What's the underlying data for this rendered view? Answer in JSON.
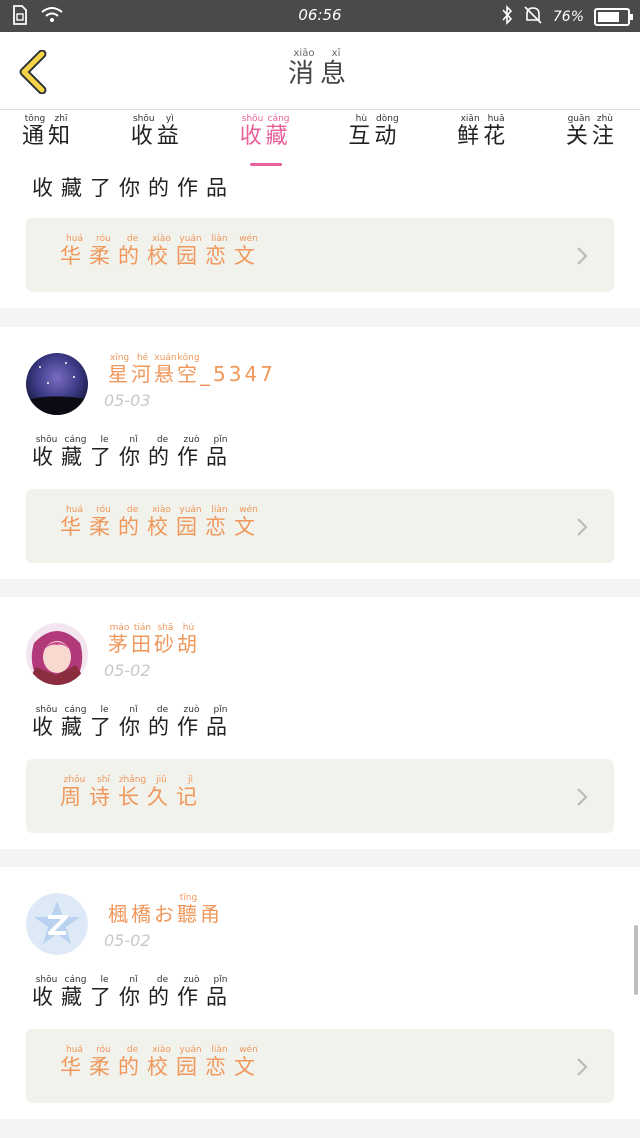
{
  "status": {
    "time": "06:56",
    "battery": "76%",
    "battery_level": 0.76
  },
  "header": {
    "title": [
      [
        "消",
        "xiāo"
      ],
      [
        "息",
        "xī"
      ]
    ]
  },
  "tabs": [
    {
      "label": [
        [
          "通",
          "tōng"
        ],
        [
          "知",
          "zhī"
        ]
      ],
      "active": false
    },
    {
      "label": [
        [
          "收",
          "shōu"
        ],
        [
          "益",
          "yì"
        ]
      ],
      "active": false
    },
    {
      "label": [
        [
          "收",
          "shōu"
        ],
        [
          "藏",
          "cáng"
        ]
      ],
      "active": true
    },
    {
      "label": [
        [
          "互",
          "hù"
        ],
        [
          "动",
          "dòng"
        ]
      ],
      "active": false
    },
    {
      "label": [
        [
          "鲜",
          "xiān"
        ],
        [
          "花",
          "huā"
        ]
      ],
      "active": false
    },
    {
      "label": [
        [
          "关",
          "guān"
        ],
        [
          "注",
          "zhù"
        ]
      ],
      "active": false
    }
  ],
  "first_card": {
    "action": [
      [
        "收",
        ""
      ],
      [
        "藏",
        ""
      ],
      [
        "了",
        ""
      ],
      [
        "你",
        ""
      ],
      [
        "的",
        ""
      ],
      [
        "作",
        ""
      ],
      [
        "品",
        ""
      ]
    ],
    "work": [
      [
        "华",
        "huá"
      ],
      [
        "柔",
        "róu"
      ],
      [
        "的",
        "de"
      ],
      [
        "校",
        "xiào"
      ],
      [
        "园",
        "yuán"
      ],
      [
        "恋",
        "liàn"
      ],
      [
        "文",
        "wén"
      ]
    ]
  },
  "cards": [
    {
      "name": [
        [
          "星",
          "xīng"
        ],
        [
          "河",
          "hé"
        ],
        [
          "悬",
          "xuán"
        ],
        [
          "空",
          "kōng"
        ],
        [
          "_5347",
          ""
        ]
      ],
      "date": "05-03",
      "avatar": "galaxy",
      "action": [
        [
          "收",
          "shōu"
        ],
        [
          "藏",
          "cáng"
        ],
        [
          "了",
          "le"
        ],
        [
          "你",
          "nǐ"
        ],
        [
          "的",
          "de"
        ],
        [
          "作",
          "zuò"
        ],
        [
          "品",
          "pǐn"
        ]
      ],
      "work": [
        [
          "华",
          "huá"
        ],
        [
          "柔",
          "róu"
        ],
        [
          "的",
          "de"
        ],
        [
          "校",
          "xiào"
        ],
        [
          "园",
          "yuán"
        ],
        [
          "恋",
          "liàn"
        ],
        [
          "文",
          "wén"
        ]
      ]
    },
    {
      "name": [
        [
          "茅",
          "máo"
        ],
        [
          "田",
          "tián"
        ],
        [
          "砂",
          "shā"
        ],
        [
          "胡",
          "hú"
        ]
      ],
      "date": "05-02",
      "avatar": "anime",
      "action": [
        [
          "收",
          "shōu"
        ],
        [
          "藏",
          "cáng"
        ],
        [
          "了",
          "le"
        ],
        [
          "你",
          "nǐ"
        ],
        [
          "的",
          "de"
        ],
        [
          "作",
          "zuò"
        ],
        [
          "品",
          "pǐn"
        ]
      ],
      "work": [
        [
          "周",
          "zhōu"
        ],
        [
          "诗",
          "shī"
        ],
        [
          "长",
          "zhǎng"
        ],
        [
          "久",
          "jiǔ"
        ],
        [
          "记",
          "jì"
        ]
      ]
    },
    {
      "name": [
        [
          "楓",
          ""
        ],
        [
          "橋",
          ""
        ],
        [
          "お",
          ""
        ],
        [
          "聽",
          "tīng"
        ],
        [
          "甬",
          ""
        ]
      ],
      "date": "05-02",
      "avatar": "default",
      "action": [
        [
          "收",
          "shōu"
        ],
        [
          "藏",
          "cáng"
        ],
        [
          "了",
          "le"
        ],
        [
          "你",
          "nǐ"
        ],
        [
          "的",
          "de"
        ],
        [
          "作",
          "zuò"
        ],
        [
          "品",
          "pǐn"
        ]
      ],
      "work": [
        [
          "华",
          "huá"
        ],
        [
          "柔",
          "róu"
        ],
        [
          "的",
          "de"
        ],
        [
          "校",
          "xiào"
        ],
        [
          "园",
          "yuán"
        ],
        [
          "恋",
          "liàn"
        ],
        [
          "文",
          "wén"
        ]
      ]
    }
  ],
  "colors": {
    "accent": "#e85f99",
    "orange": "#f0975b",
    "card_bg": "#f2f2ec"
  }
}
